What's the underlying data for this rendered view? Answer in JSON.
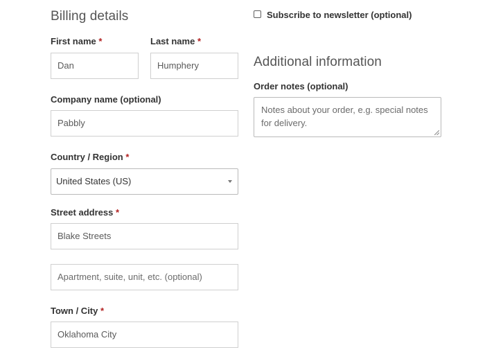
{
  "billing": {
    "title": "Billing details",
    "required_mark": "*",
    "first_name": {
      "label": "First name",
      "value": "Dan"
    },
    "last_name": {
      "label": "Last name",
      "value": "Humphery"
    },
    "company": {
      "label": "Company name (optional)",
      "value": "Pabbly"
    },
    "country": {
      "label": "Country / Region",
      "value": "United States (US)"
    },
    "street": {
      "label": "Street address",
      "value": "Blake Streets",
      "line2_placeholder": "Apartment, suite, unit, etc. (optional)"
    },
    "city": {
      "label": "Town / City",
      "value": "Oklahoma City"
    }
  },
  "newsletter": {
    "label": "Subscribe to newsletter (optional)",
    "checked": false
  },
  "additional": {
    "title": "Additional information",
    "notes_label": "Order notes (optional)",
    "notes_placeholder": "Notes about your order, e.g. special notes for delivery."
  },
  "colors": {
    "required": "#b22222",
    "border": "#cfcfcf",
    "text": "#333333"
  }
}
